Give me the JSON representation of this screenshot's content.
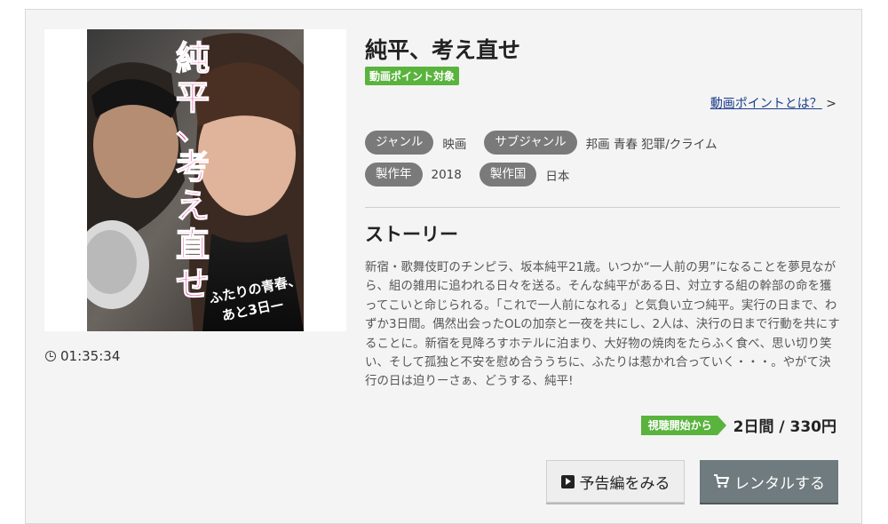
{
  "movie": {
    "title": "純平、考え直せ",
    "point_badge": "動画ポイント対象",
    "point_link": "動画ポイントとは？",
    "point_link_arrow": ">",
    "duration": "01:35:34",
    "poster": {
      "title_art": "純平、考え直せ",
      "tagline_1": "ふたりの青春、",
      "tagline_2": "あと3日—"
    }
  },
  "meta": {
    "genre_label": "ジャンル",
    "genre_value": "映画",
    "subgenre_label": "サブジャンル",
    "subgenre_value": "邦画 青春 犯罪/クライム",
    "year_label": "製作年",
    "year_value": "2018",
    "country_label": "製作国",
    "country_value": "日本"
  },
  "story": {
    "heading": "ストーリー",
    "text": "新宿・歌舞伎町のチンピラ、坂本純平21歳。いつか“一人前の男”になることを夢見ながら、組の雑用に追われる日々を送る。そんな純平がある日、対立する組の幹部の命を獲ってこいと命じられる。「これで一人前になれる」と気負い立つ純平。実行の日まで、わずか3日間。偶然出会ったOLの加奈と一夜を共にし、2人は、決行の日まで行動を共にすることに。新宿を見降ろすホテルに泊まり、大好物の焼肉をたらふく食べ、思い切り笑い、そして孤独と不安を慰め合ううちに、ふたりは惹かれ合っていく・・・。やがて決行の日は迫りーさぁ、どうする、純平!"
  },
  "rental": {
    "period_tag": "視聴開始から",
    "price": "2日間 / 330円",
    "trailer_button": "予告編をみる",
    "rent_button": "レンタルする"
  },
  "colors": {
    "accent_green": "#59b33c",
    "pill_gray": "#7a7a7a",
    "rent_button": "#6f7b7e",
    "title_pink": "#e6198a"
  },
  "icons": {
    "clock": "clock-icon",
    "play": "play-icon",
    "cart": "cart-icon"
  }
}
